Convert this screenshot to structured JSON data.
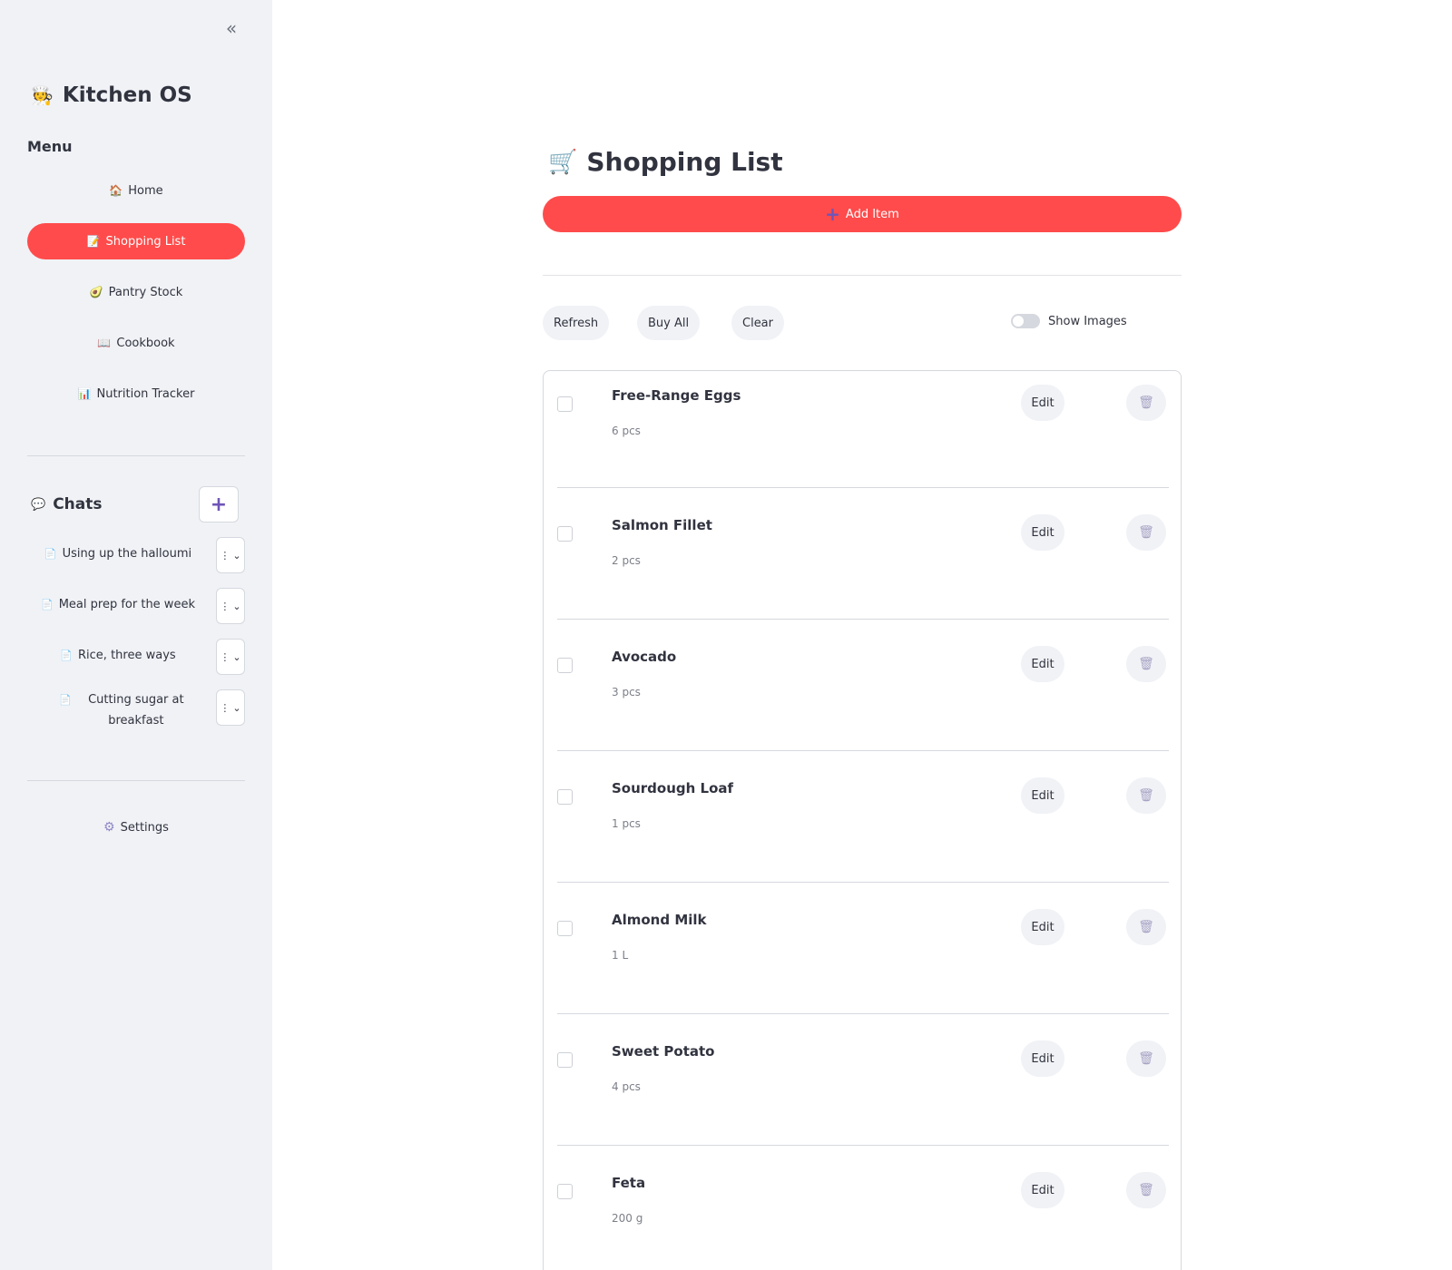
{
  "sidebar": {
    "collapse_icon": "double-chevron-left-icon",
    "brand": {
      "icon": "🧑‍🍳",
      "title": "Kitchen OS"
    },
    "menu_heading": "Menu",
    "nav": [
      {
        "icon": "🏠",
        "label": "Home",
        "active": false
      },
      {
        "icon": "📝",
        "label": "Shopping List",
        "active": true
      },
      {
        "icon": "🥑",
        "label": "Pantry Stock",
        "active": false
      },
      {
        "icon": "📖",
        "label": "Cookbook",
        "active": false
      },
      {
        "icon": "📊",
        "label": "Nutrition Tracker",
        "active": false
      }
    ],
    "chats": {
      "icon": "💬",
      "heading": "Chats",
      "new_label": "+",
      "items": [
        {
          "icon": "📄",
          "label": "Using up the halloumi"
        },
        {
          "icon": "📄",
          "label": "Meal prep for the week"
        },
        {
          "icon": "📄",
          "label": "Rice, three ways"
        },
        {
          "icon": "📄",
          "label": "Cutting sugar at breakfast"
        }
      ],
      "menu_dots": "⋮",
      "menu_chevron": "⌄"
    },
    "settings": {
      "icon": "⚙",
      "label": "Settings"
    }
  },
  "main": {
    "title_icon": "🛒",
    "title": "Shopping List",
    "add_button": {
      "icon": "+",
      "label": "Add Item"
    },
    "actions": {
      "refresh": "Refresh",
      "buy_all": "Buy All",
      "clear": "Clear"
    },
    "toggle": {
      "label": "Show Images",
      "on": false
    },
    "items": [
      {
        "name": "Free-Range Eggs",
        "qty": "6 pcs"
      },
      {
        "name": "Salmon Fillet",
        "qty": "2 pcs"
      },
      {
        "name": "Avocado",
        "qty": "3 pcs"
      },
      {
        "name": "Sourdough Loaf",
        "qty": "1 pcs"
      },
      {
        "name": "Almond Milk",
        "qty": "1 L"
      },
      {
        "name": "Sweet Potato",
        "qty": "4 pcs"
      },
      {
        "name": "Feta",
        "qty": "200 g"
      }
    ],
    "edit_label": "Edit",
    "delete_icon": "🗑"
  },
  "colors": {
    "accent": "#ff4b4b",
    "sidebar_bg": "#f0f2f6",
    "text": "#31333f",
    "muted_text": "#7c7f88",
    "purple": "#6e55b8"
  }
}
